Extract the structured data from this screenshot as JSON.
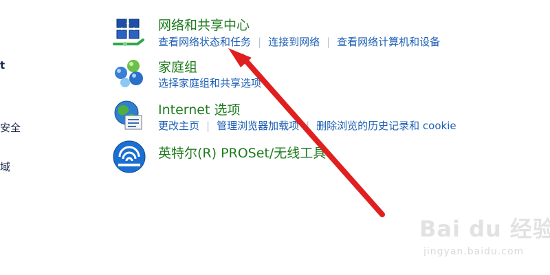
{
  "left_edge": {
    "line1": "t",
    "line2": "安全",
    "line3": "域"
  },
  "network_sharing": {
    "icon": "network-center-icon",
    "title": "网络和共享中心",
    "links": [
      "查看网络状态和任务",
      "连接到网络",
      "查看网络计算机和设备"
    ]
  },
  "homegroup": {
    "icon": "homegroup-icon",
    "title": "家庭组",
    "links": [
      "选择家庭组和共享选项"
    ]
  },
  "internet_options": {
    "icon": "internet-globe-icon",
    "title": "Internet 选项",
    "links": [
      "更改主页",
      "管理浏览器加载项",
      "删除浏览的历史记录和 cookie"
    ]
  },
  "intel_proset": {
    "icon": "wireless-icon",
    "title": "英特尔(R) PROSet/无线工具"
  },
  "annotation": {
    "arrow_color": "#e02020"
  },
  "watermark": {
    "logo": "Bai du 经验",
    "url": "jingyan.baidu.com"
  },
  "colors": {
    "title_green": "#1e7b1e",
    "link_blue": "#1c5fb4",
    "separator": "#b7c3d6"
  }
}
